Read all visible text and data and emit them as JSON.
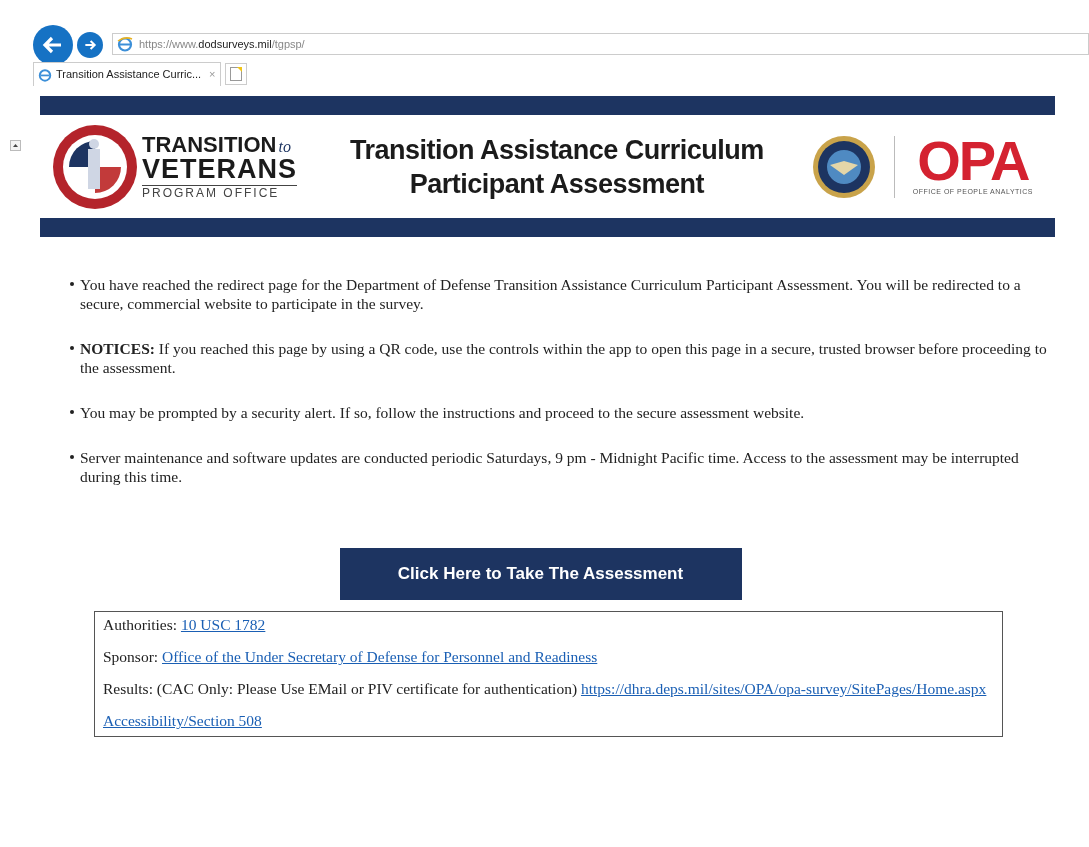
{
  "browser": {
    "url_prefix": "https://www.",
    "url_domain": "dodsurveys.mil",
    "url_path": "/tgpsp/",
    "tabs": [
      {
        "label": "Transition Assistance Curric...",
        "selected": true,
        "close": "×"
      }
    ]
  },
  "header": {
    "left_logo": {
      "word1": "TRANSITION",
      "word1_suffix": "to",
      "word2": "VETERANS",
      "word3": "PROGRAM OFFICE"
    },
    "title_lines": [
      "Transition Assistance Curriculum",
      "Participant Assessment"
    ],
    "right_logo": {
      "name": "OPA",
      "subtitle": "OFFICE OF PEOPLE ANALYTICS"
    }
  },
  "bullets": [
    "You have reached the redirect page for the Department of Defense Transition Assistance Curriculum Participant Assessment. You will be redirected to a secure, commercial website to participate in the survey.",
    "**NOTICES:** If you reached this page by using a QR code, use the controls within the app to open this page in a secure, trusted browser before proceeding to the assessment.",
    "You may be prompted by a security alert. If so, follow the instructions and proceed to the secure assessment website.",
    "Server maintenance and software updates are conducted periodic Saturdays, 9 pm - Midnight Pacific time. Access to the assessment may be interrupted during this time."
  ],
  "assessment_button": "Click Here to Take The Assessment",
  "info_box": [
    {
      "label": "Authorities:",
      "link": "10 USC 1782"
    },
    {
      "label": "Sponsor:",
      "link": "Office of the Under Secretary of Defense for Personnel and Readiness"
    },
    {
      "label": "Results: (CAC Only: Please Use EMail or PIV certificate for authentication)",
      "link": "https://dhra.deps.mil/sites/OPA/opa-survey/SitePages/Home.aspx"
    },
    {
      "link": "Accessibility/Section 508"
    }
  ]
}
